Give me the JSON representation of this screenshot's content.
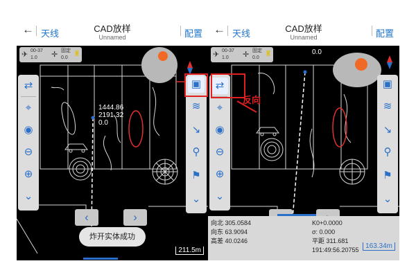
{
  "header": {
    "back_glyph": "←",
    "link_label": "天线",
    "title": "CAD放样",
    "subtitle": "Unnamed",
    "config_label": "配置"
  },
  "status": {
    "signal_label": "00-37",
    "signal_value": "1.0",
    "fix_label": "固定",
    "fix_value": "0.0",
    "fix_value_2": "0.0"
  },
  "left_panel": {
    "coord_north": "1444.86",
    "coord_east": "2191.32",
    "coord_elev": "0.0",
    "toast": "炸开实体成功",
    "scale": "211.5m"
  },
  "right_panel": {
    "annotation": "反向",
    "bottom_info": {
      "north": "向北 305.0584",
      "east": "向东 63.9094",
      "elev": "高差 40.0246",
      "k": "K0+0.0000",
      "sigma": "σ: 0.000",
      "flat": "平距 311.681",
      "angle": "191:49:56.20755"
    },
    "scale": "163.34m"
  },
  "colors": {
    "accent": "#2a6fc9",
    "compass_dot": "#f06a26",
    "annotation_red": "#e02020"
  },
  "icons": {
    "left_toolbar": [
      "swap-icon",
      "locate-icon",
      "globe-icon",
      "zoom-out-icon",
      "zoom-in-icon",
      "expand-down-icon"
    ],
    "right_toolbar": [
      "cad-layer-icon",
      "layers-icon",
      "measure-icon",
      "point-icon",
      "location-pin-icon",
      "expand-down-icon"
    ]
  }
}
